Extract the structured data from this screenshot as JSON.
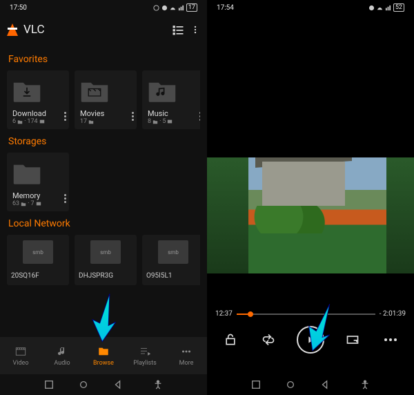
{
  "left": {
    "status": {
      "time": "17:50",
      "battery": "17"
    },
    "app_title": "VLC",
    "sections": {
      "favorites": {
        "title": "Favorites",
        "items": [
          {
            "title": "Download",
            "folders": "6",
            "media": "174"
          },
          {
            "title": "Movies",
            "folders": "17",
            "media": ""
          },
          {
            "title": "Music",
            "folders": "8",
            "media": "5"
          }
        ]
      },
      "storages": {
        "title": "Storages",
        "items": [
          {
            "title": "Memory",
            "folders": "63",
            "media": "7"
          }
        ]
      },
      "local_network": {
        "title": "Local Network",
        "items": [
          {
            "label": "smb",
            "title": "20SQ16F"
          },
          {
            "label": "smb",
            "title": "DHJSPR3G"
          },
          {
            "label": "smb",
            "title": "O95I5L1"
          }
        ]
      }
    },
    "nav": {
      "video": "Video",
      "audio": "Audio",
      "browse": "Browse",
      "playlists": "Playlists",
      "more": "More"
    }
  },
  "right": {
    "status": {
      "time": "17:54",
      "battery": "52"
    },
    "player": {
      "current_time": "12:37",
      "remaining_time": "- 2:01:39"
    }
  }
}
